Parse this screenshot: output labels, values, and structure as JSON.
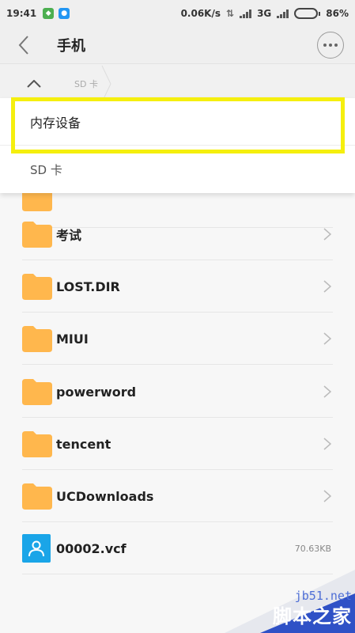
{
  "status_bar": {
    "time": "19:41",
    "net_speed": "0.06K/s",
    "network": "3G",
    "battery": "86%",
    "battery_level": 0.86
  },
  "header": {
    "title": "手机"
  },
  "breadcrumb": {
    "current": "SD 卡"
  },
  "storage_dropdown": {
    "items": [
      "内存设备",
      "SD 卡"
    ]
  },
  "files": [
    {
      "name": "考试",
      "type": "folder"
    },
    {
      "name": "LOST.DIR",
      "type": "folder"
    },
    {
      "name": "MIUI",
      "type": "folder"
    },
    {
      "name": "powerword",
      "type": "folder"
    },
    {
      "name": "tencent",
      "type": "folder"
    },
    {
      "name": "UCDownloads",
      "type": "folder"
    },
    {
      "name": "00002.vcf",
      "type": "contact-file",
      "size": "70.63KB"
    }
  ],
  "watermark": {
    "url": "jb51.net",
    "site": "脚本之家"
  },
  "colors": {
    "folder": "#ffb74d",
    "highlight": "#f5ef0e",
    "contact": "#1aa5e8"
  }
}
